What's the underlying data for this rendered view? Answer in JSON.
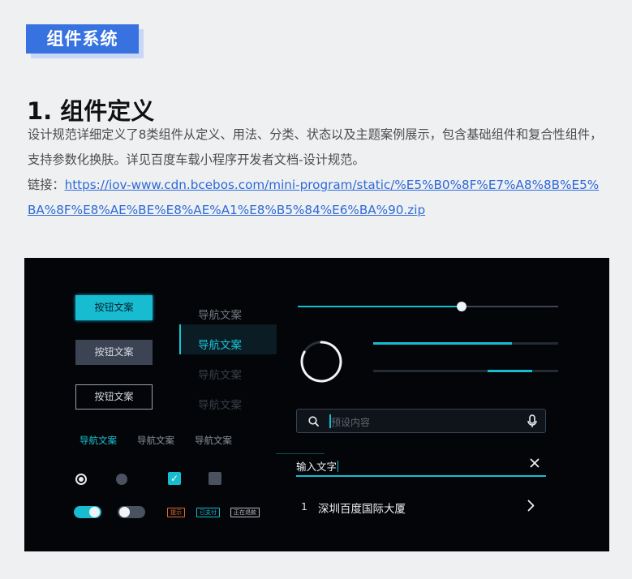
{
  "badge": {
    "label": "组件系统"
  },
  "section": {
    "heading": "1. 组件定义",
    "description": "设计规范详细定义了8类组件从定义、用法、分类、状态以及主题案例展示，包含基础组件和复合性组件，支持参数化换肤。详见百度车载小程序开发者文档-设计规范。",
    "link_prefix": "链接：",
    "link_url": "https://iov-www.cdn.bcebos.com/mini-program/static/%E5%B0%8F%E7%A8%8B%E5%BA%8F%E8%AE%BE%E8%AE%A1%E8%B5%84%E6%BA%90.zip"
  },
  "demo": {
    "buttons": [
      "按钮文案",
      "按钮文案",
      "按钮文案"
    ],
    "vertical_nav": [
      "导航文案",
      "导航文案",
      "导航文案",
      "导航文案"
    ],
    "horizontal_nav": [
      "导航文案",
      "导航文案",
      "导航文案"
    ],
    "radio_checked": true,
    "checkbox_checked": true,
    "toggle_on": true,
    "tags": [
      "提示",
      "已支付",
      "正在退款"
    ],
    "slider_value": 0.63,
    "progress1": 0.75,
    "progress2": {
      "start": 0.62,
      "end": 0.86
    },
    "search": {
      "placeholder": "预设内容"
    },
    "text_input": {
      "value": "输入文字"
    },
    "list_item": {
      "index": "1",
      "label": "深圳百度国际大厦"
    },
    "colors": {
      "accent": "#17bcd0",
      "panel_bg": "#030508",
      "badge": "#3772e0",
      "link": "#2d6ad8"
    }
  }
}
